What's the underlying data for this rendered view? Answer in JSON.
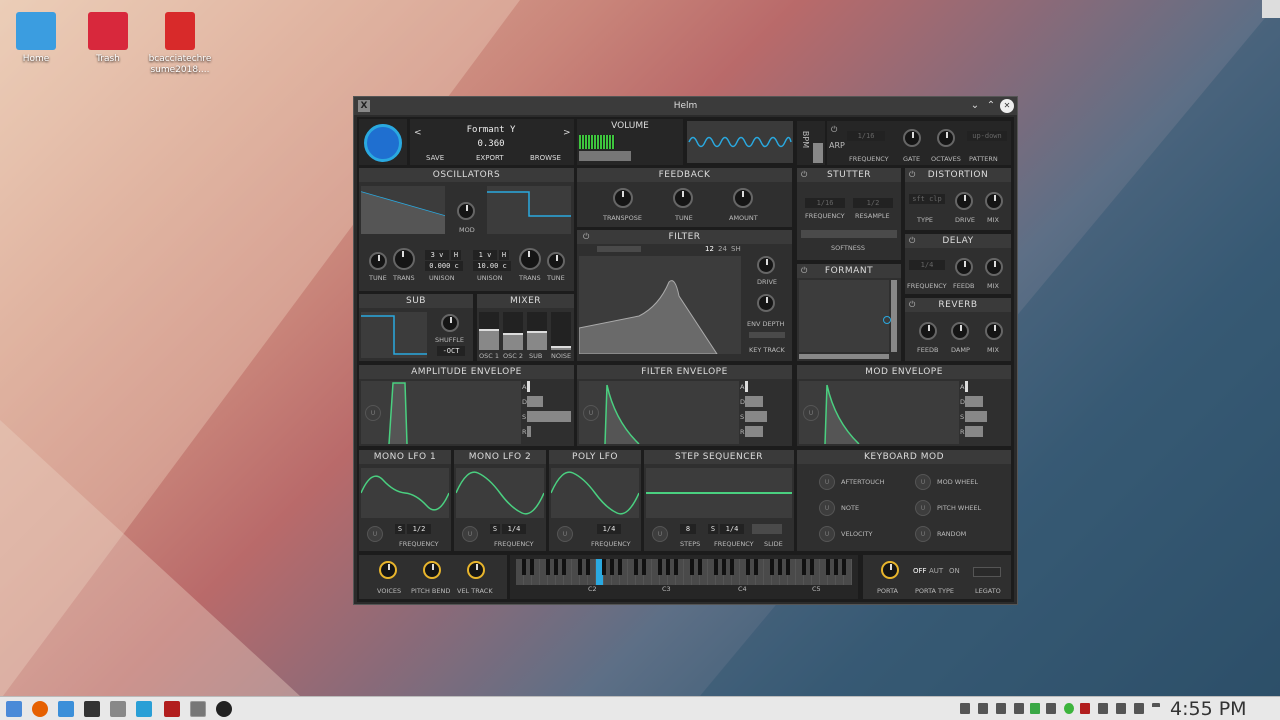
{
  "desktop": {
    "icons": [
      {
        "label": "Home",
        "color": "#3b9de0"
      },
      {
        "label": "Trash",
        "color": "#d8283c"
      },
      {
        "label": "bcacciatechre sume2018....",
        "color": "#d82a2a"
      }
    ]
  },
  "window": {
    "title": "Helm",
    "min": "⌄",
    "max": "⌃",
    "close": "✕"
  },
  "preset": {
    "name": "Formant Y",
    "value": "0.360",
    "prev": "<",
    "next": ">",
    "save": "SAVE",
    "export": "EXPORT",
    "browse": "BROWSE"
  },
  "volume": {
    "title": "VOLUME"
  },
  "bpm": "BPM",
  "arp": {
    "title": "ARP",
    "frequency": "1/16",
    "labels": [
      "FREQUENCY",
      "GATE",
      "OCTAVES",
      "PATTERN"
    ],
    "pattern": "up-down"
  },
  "oscillators": {
    "title": "OSCILLATORS",
    "mod": "MOD",
    "osc1": {
      "tune": "TUNE",
      "trans": "TRANS",
      "voices": "3 v",
      "h": "H",
      "detune": "0.000 c",
      "unison": "UNISON"
    },
    "osc2": {
      "voices": "1 v",
      "h": "H",
      "detune": "10.00 c",
      "unison": "UNISON",
      "trans": "TRANS",
      "tune": "TUNE"
    }
  },
  "feedback": {
    "title": "FEEDBACK",
    "labels": [
      "TRANSPOSE",
      "TUNE",
      "AMOUNT"
    ]
  },
  "filter": {
    "title": "FILTER",
    "modes": [
      "12",
      "24",
      "SH"
    ],
    "drive": "DRIVE",
    "env_depth": "ENV DEPTH",
    "key_track": "KEY TRACK"
  },
  "stutter": {
    "title": "STUTTER",
    "frequency": "1/16",
    "resample": "1/2",
    "labels": [
      "FREQUENCY",
      "RESAMPLE"
    ],
    "softness": "SOFTNESS"
  },
  "distortion": {
    "title": "DISTORTION",
    "type": "sft clp",
    "labels": [
      "TYPE",
      "DRIVE",
      "MIX"
    ]
  },
  "delay": {
    "title": "DELAY",
    "freq": "1/4",
    "labels": [
      "FREQUENCY",
      "FEEDB",
      "MIX"
    ]
  },
  "formant": {
    "title": "FORMANT"
  },
  "reverb": {
    "title": "REVERB",
    "labels": [
      "FEEDB",
      "DAMP",
      "MIX"
    ]
  },
  "sub": {
    "title": "SUB",
    "shuffle": "SHUFFLE",
    "oct": "-OCT"
  },
  "mixer": {
    "title": "MIXER",
    "labels": [
      "OSC 1",
      "OSC 2",
      "SUB",
      "NOISE"
    ],
    "levels": [
      0.55,
      0.45,
      0.5,
      0.1
    ]
  },
  "envelopes": [
    {
      "title": "AMPLITUDE ENVELOPE"
    },
    {
      "title": "FILTER ENVELOPE"
    },
    {
      "title": "MOD ENVELOPE"
    }
  ],
  "adsr": [
    "A",
    "D",
    "S",
    "R"
  ],
  "lfos": [
    {
      "title": "MONO LFO 1",
      "s": "S",
      "freq": "1/2",
      "label": "FREQUENCY"
    },
    {
      "title": "MONO LFO 2",
      "s": "S",
      "freq": "1/4",
      "label": "FREQUENCY"
    },
    {
      "title": "POLY LFO",
      "freq": "1/4",
      "label": "FREQUENCY"
    }
  ],
  "step_sequencer": {
    "title": "STEP SEQUENCER",
    "steps": "8",
    "s": "S",
    "freq": "1/4",
    "labels": [
      "STEPS",
      "FREQUENCY",
      "SLIDE"
    ]
  },
  "keyboard_mod": {
    "title": "KEYBOARD MOD",
    "items": [
      "AFTERTOUCH",
      "MOD WHEEL",
      "NOTE",
      "PITCH WHEEL",
      "VELOCITY",
      "RANDOM"
    ]
  },
  "bottom": {
    "voices": "VOICES",
    "pitch_bend": "PITCH BEND",
    "vel_track": "VEL TRACK",
    "octaves": [
      "C2",
      "C3",
      "C4",
      "C5"
    ],
    "porta": "PORTA",
    "porta_type": "PORTA TYPE",
    "legato": "LEGATO",
    "modes": [
      "OFF",
      "AUT",
      "ON"
    ]
  },
  "clock": "4:55 PM",
  "colors": {
    "accent": "#2aa9e0",
    "green": "#4ad080",
    "bg": "#1c1c1c"
  }
}
